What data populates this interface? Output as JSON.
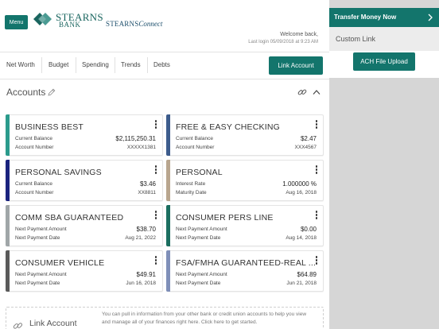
{
  "header": {
    "menu_label": "Menu",
    "logo_primary_line1": "STEARNS",
    "logo_primary_line2": "BANK",
    "logo_secondary_a": "STEARNS",
    "logo_secondary_b": "Connect",
    "welcome": "Welcome back,",
    "last_login": "Last login 05/09/2018 at 9:23 AM"
  },
  "nav": {
    "tabs": [
      "Net Worth",
      "Budget",
      "Spending",
      "Trends",
      "Debts"
    ],
    "link_account_label": "Link Account"
  },
  "accounts": {
    "title": "Accounts",
    "cards": [
      {
        "name": "BUSINESS BEST",
        "label1": "Current Balance",
        "value1": "$2,115,250.31",
        "label2": "Account Number",
        "value2": "XXXXX1381",
        "color": "#2b9b8c"
      },
      {
        "name": "FREE & EASY CHECKING",
        "label1": "Current Balance",
        "value1": "$2.47",
        "label2": "Account Number",
        "value2": "XXX4567",
        "color": "#3d5c8c"
      },
      {
        "name": "PERSONAL SAVINGS",
        "label1": "Current Balance",
        "value1": "$3.46",
        "label2": "Account Number",
        "value2": "XX8811",
        "color": "#1a237e"
      },
      {
        "name": "PERSONAL",
        "label1": "Interest Rate",
        "value1": "1.000000 %",
        "label2": "Maturity Date",
        "value2": "Aug 16, 2018",
        "color": "#b8a58e"
      },
      {
        "name": "COMM SBA GUARANTEED",
        "label1": "Next Payment Amount",
        "value1": "$38.70",
        "label2": "Next Payment Date",
        "value2": "Aug 21, 2022",
        "color": "#a0a6a8"
      },
      {
        "name": "CONSUMER PERS LINE",
        "label1": "Next Payment Amount",
        "value1": "$0.00",
        "label2": "Next Payment Date",
        "value2": "Aug 14, 2018",
        "color": "#1b6e5f"
      },
      {
        "name": "CONSUMER VEHICLE",
        "label1": "Next Payment Amount",
        "value1": "$49.91",
        "label2": "Next Payment Date",
        "value2": "Jun 16, 2018",
        "color": "#5a5a5a"
      },
      {
        "name": "FSA/FMHA GUARANTEED-REAL ...",
        "label1": "Next Payment Amount",
        "value1": "$64.89",
        "label2": "Next Payment Date",
        "value2": "Jun 21, 2018",
        "color": "#7f8fb8"
      }
    ]
  },
  "footer": {
    "title": "Link Account",
    "text": "You can pull in information from your other bank or credit union accounts to help you view and manage all of your finances right here. Click here to get started."
  },
  "sidebar": {
    "transfer_label": "Transfer Money Now",
    "custom_link_label": "Custom Link",
    "ach_label": "ACH File Upload"
  },
  "colors": {
    "brand": "#13756c",
    "logo_green": "#19655f"
  }
}
